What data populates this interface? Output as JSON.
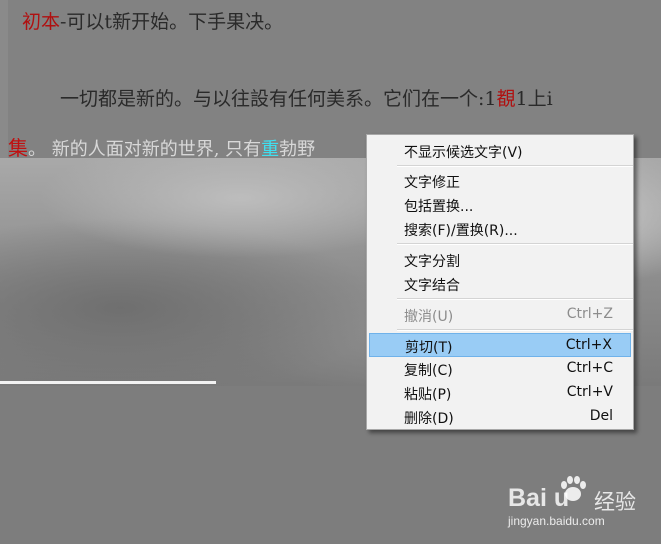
{
  "document": {
    "line1": {
      "red": "初本",
      "rest": "-可以t新开始。下手果决。"
    },
    "line2": {
      "pre": "一切都是新的。与以往設有任何美系。它们在一个:1",
      "red": "覩",
      "post": "1上i"
    },
    "line3": {
      "red": "集",
      "mid": "。 新的人面对新的世界, 只有",
      "cyan": "重",
      "post": "勃野"
    }
  },
  "context_menu": {
    "items": [
      {
        "label": "不显示候选文字(V)",
        "shortcut": "",
        "disabled": false,
        "highlighted": false
      },
      {
        "label": "文字修正",
        "shortcut": "",
        "disabled": false,
        "highlighted": false
      },
      {
        "label": "包括置换...",
        "shortcut": "",
        "disabled": false,
        "highlighted": false
      },
      {
        "label": "搜索(F)/置换(R)...",
        "shortcut": "",
        "disabled": false,
        "highlighted": false
      },
      {
        "label": "文字分割",
        "shortcut": "",
        "disabled": false,
        "highlighted": false
      },
      {
        "label": "文字结合",
        "shortcut": "",
        "disabled": false,
        "highlighted": false
      },
      {
        "label": "撤消(U)",
        "shortcut": "Ctrl+Z",
        "disabled": true,
        "highlighted": false
      },
      {
        "label": "剪切(T)",
        "shortcut": "Ctrl+X",
        "disabled": false,
        "highlighted": true
      },
      {
        "label": "复制(C)",
        "shortcut": "Ctrl+C",
        "disabled": false,
        "highlighted": false
      },
      {
        "label": "粘贴(P)",
        "shortcut": "Ctrl+V",
        "disabled": false,
        "highlighted": false
      },
      {
        "label": "删除(D)",
        "shortcut": "Del",
        "disabled": false,
        "highlighted": false
      }
    ],
    "highlight_color": "#99ccf5",
    "disabled_color": "#8d8d8d"
  },
  "watermark": {
    "logo": "Bai  u",
    "brand_cn": "经验",
    "url": "jingyan.baidu.com",
    "icon": "paw-icon"
  }
}
